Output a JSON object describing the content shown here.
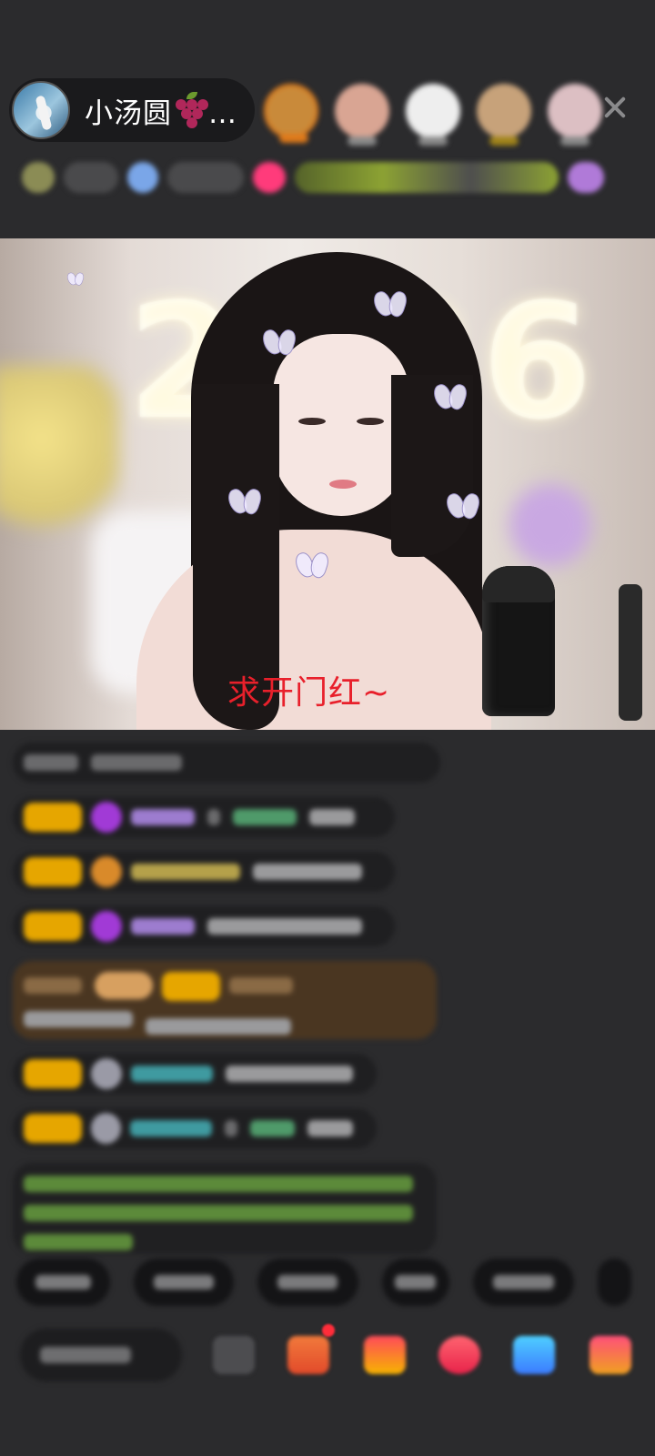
{
  "header": {
    "host_name": "小汤圆",
    "host_name_suffix": "…",
    "host_emoji_icon": "grape-icon",
    "viewer_avatars": [
      {
        "color": "#c98a3a",
        "tag": "#e07a1a"
      },
      {
        "color": "#d9a593",
        "tag": "#8a8a8a"
      },
      {
        "color": "#eeeeee",
        "tag": "#8a8a8a"
      },
      {
        "color": "#c7a27a",
        "tag": "#a1841a"
      },
      {
        "color": "#dcbfc3",
        "tag": "#8a8a8a"
      }
    ],
    "close_icon": "close-icon"
  },
  "video": {
    "caption": "求开门红~",
    "background_digits": "2026",
    "caption_color": "#e8202b"
  },
  "chat": {
    "messages": [
      {
        "type": "plain"
      },
      {
        "type": "gift-fan"
      },
      {
        "type": "gift-fan-orange"
      },
      {
        "type": "gift-fan"
      },
      {
        "type": "highlight"
      },
      {
        "type": "grey-avatar"
      },
      {
        "type": "grey-avatar"
      },
      {
        "type": "system-notice"
      }
    ]
  },
  "bottom": {
    "quick_replies_count": 6,
    "tool_icons": [
      "face-icon",
      "gift-box-icon",
      "treasure-icon",
      "heart-gift-icon",
      "game-icon",
      "shop-icon"
    ]
  }
}
